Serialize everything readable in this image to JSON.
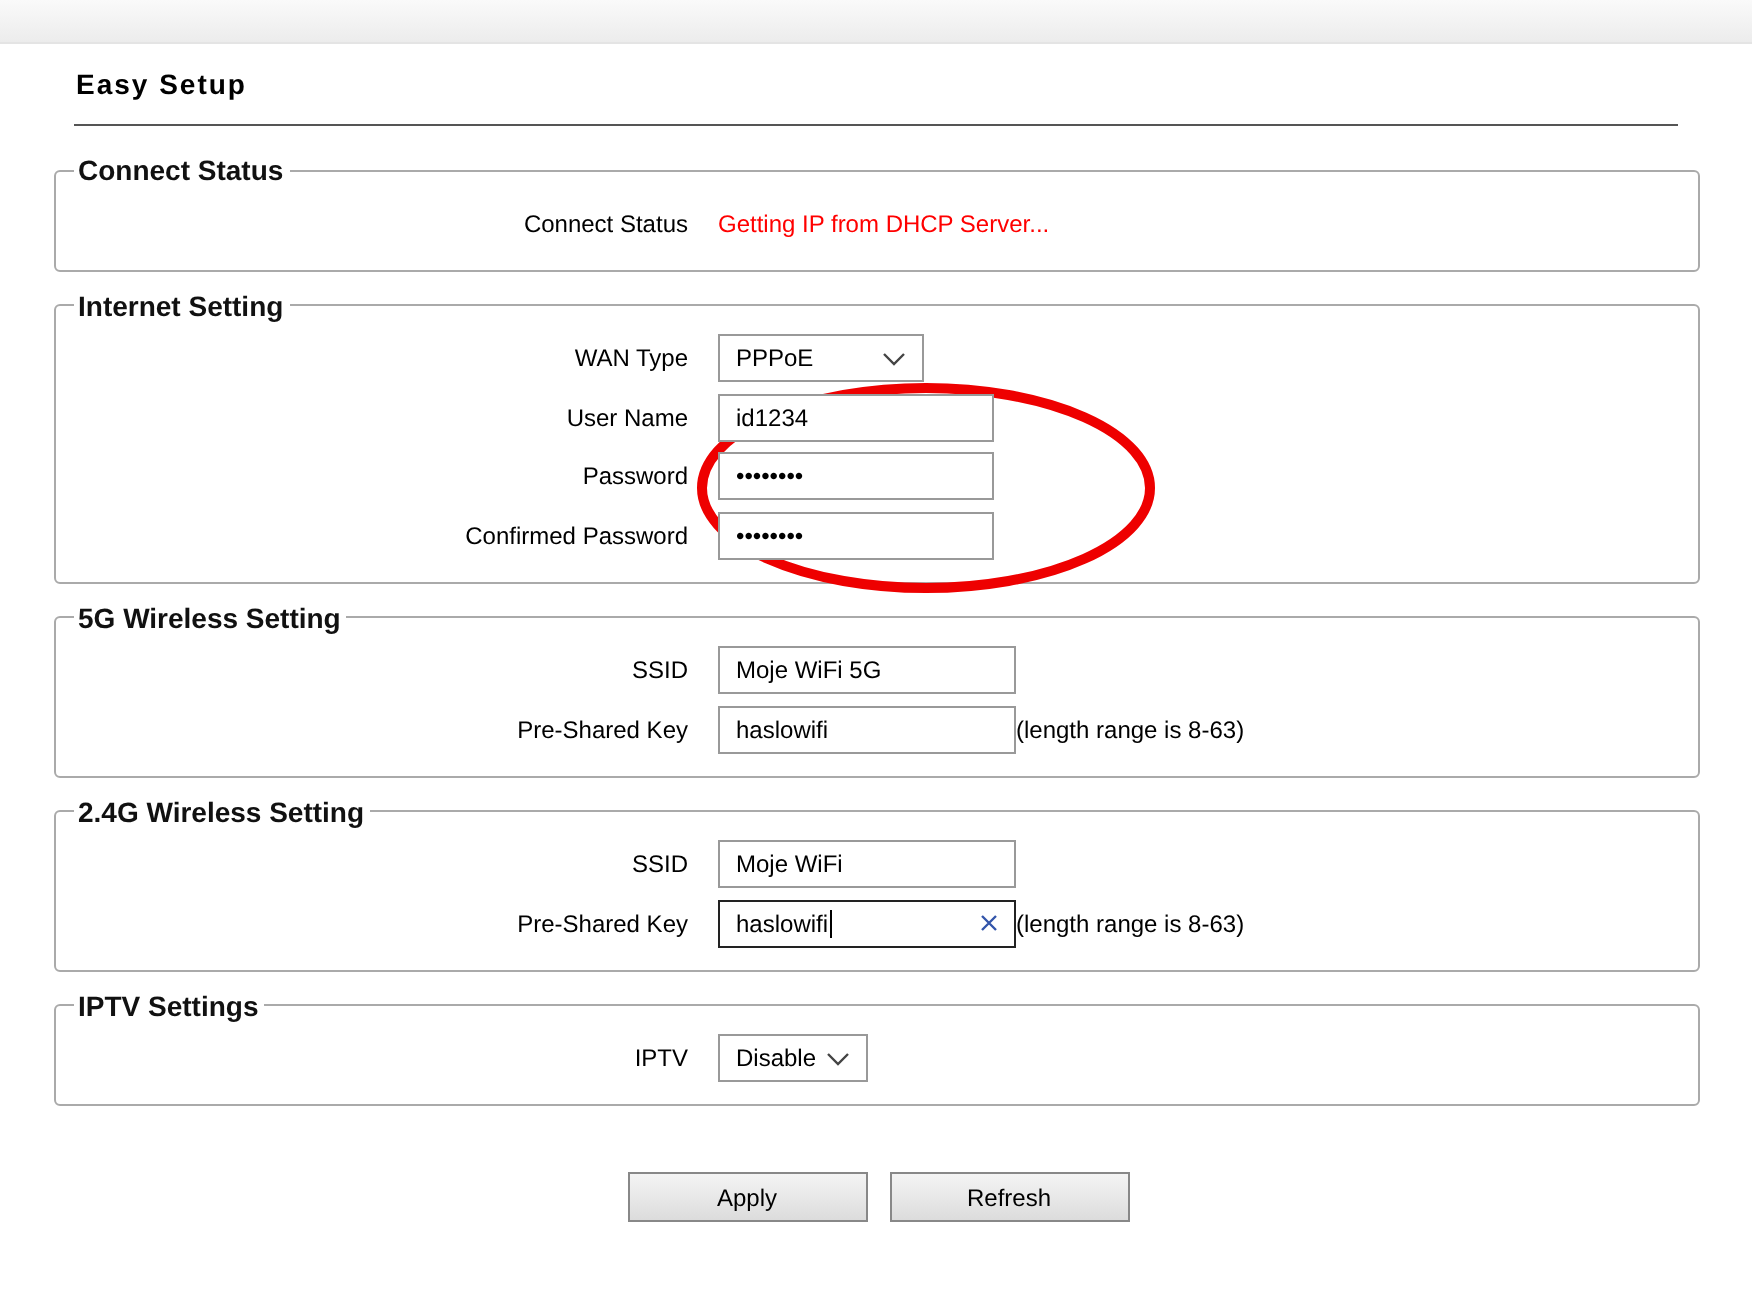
{
  "page": {
    "title": "Easy Setup"
  },
  "sections": [
    {
      "legend": "Connect Status",
      "rows": [
        {
          "kind": "status",
          "label": "Connect Status",
          "value": "Getting IP from DHCP Server..."
        }
      ]
    },
    {
      "legend": "Internet Setting",
      "highlighted": true,
      "rows": [
        {
          "kind": "select",
          "label": "WAN Type",
          "value": "PPPoE"
        },
        {
          "kind": "text",
          "label": "User Name",
          "value": "id1234"
        },
        {
          "kind": "text",
          "label": "Password",
          "value": "••••••••"
        },
        {
          "kind": "text",
          "label": "Confirmed Password",
          "value": "••••••••"
        }
      ]
    },
    {
      "legend": "5G Wireless Setting",
      "rows": [
        {
          "kind": "text",
          "wide": true,
          "label": "SSID",
          "value": "Moje WiFi 5G"
        },
        {
          "kind": "text",
          "wide": true,
          "label": "Pre-Shared Key",
          "value": "haslowifi",
          "hint": "(length range is 8-63)"
        }
      ]
    },
    {
      "legend": "2.4G Wireless Setting",
      "rows": [
        {
          "kind": "text",
          "wide": true,
          "label": "SSID",
          "value": "Moje WiFi"
        },
        {
          "kind": "text",
          "wide": true,
          "focused": true,
          "label": "Pre-Shared Key",
          "value": "haslowifi",
          "hint": "(length range is 8-63)"
        }
      ]
    },
    {
      "legend": "IPTV Settings",
      "rows": [
        {
          "kind": "select",
          "small": true,
          "label": "IPTV",
          "value": "Disable"
        }
      ]
    }
  ],
  "buttons": [
    "Apply",
    "Refresh"
  ]
}
